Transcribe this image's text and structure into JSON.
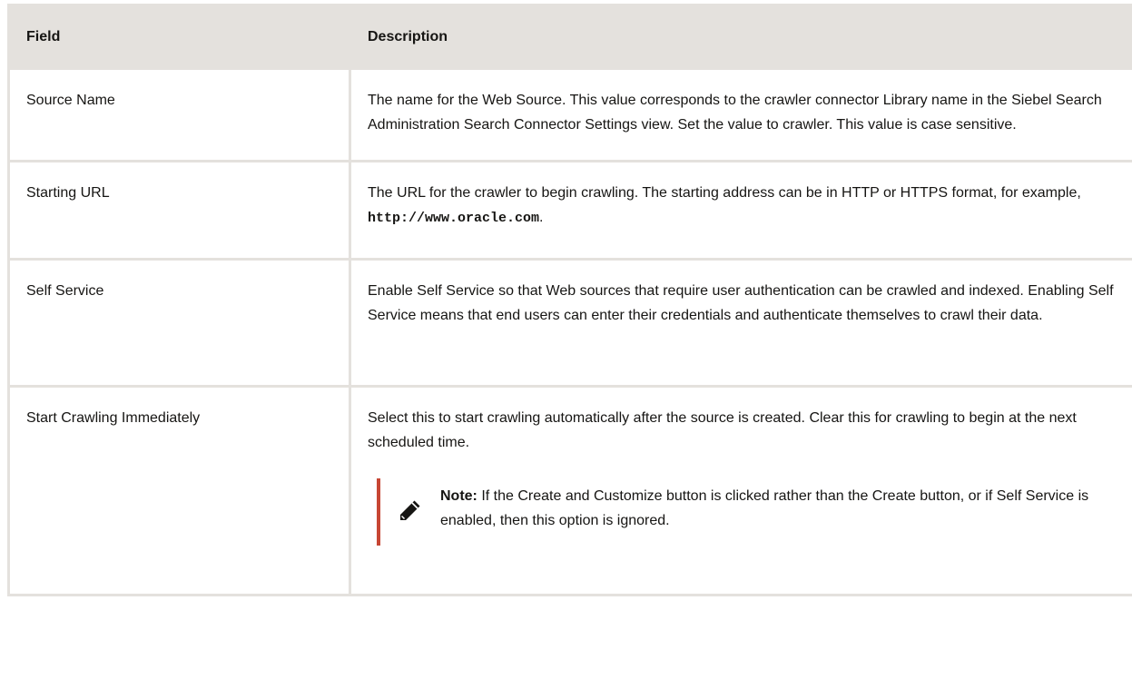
{
  "table": {
    "headers": {
      "field": "Field",
      "description": "Description"
    },
    "rows": [
      {
        "field": "Source Name",
        "description": "The name for the Web Source. This value corresponds to the crawler connector Library name in the Siebel Search Administration Search Connector Settings view. Set the value to crawler. This value is case sensitive."
      },
      {
        "field": "Starting URL",
        "description_prefix": "The URL for the crawler to begin crawling. The starting address can be in HTTP or HTTPS format, for example, ",
        "description_code": "http://www.oracle.com",
        "description_suffix": "."
      },
      {
        "field": "Self Service",
        "description": "Enable Self Service so that Web sources that require user authentication can be crawled and indexed. Enabling Self Service means that end users can enter their credentials and authenticate themselves to crawl their data."
      },
      {
        "field": "Start Crawling Immediately",
        "description": "Select this to start crawling automatically after the source is created. Clear this for crawling to begin at the next scheduled time.",
        "note": {
          "icon": "pencil-icon",
          "label": "Note:",
          "text": " If the Create and Customize button is clicked rather than the Create button, or if Self Service is enabled, then this option is ignored."
        }
      }
    ]
  },
  "colors": {
    "header_bg": "#e4e1dd",
    "border": "#e4e1dd",
    "note_accent": "#c74634",
    "text": "#161513"
  }
}
